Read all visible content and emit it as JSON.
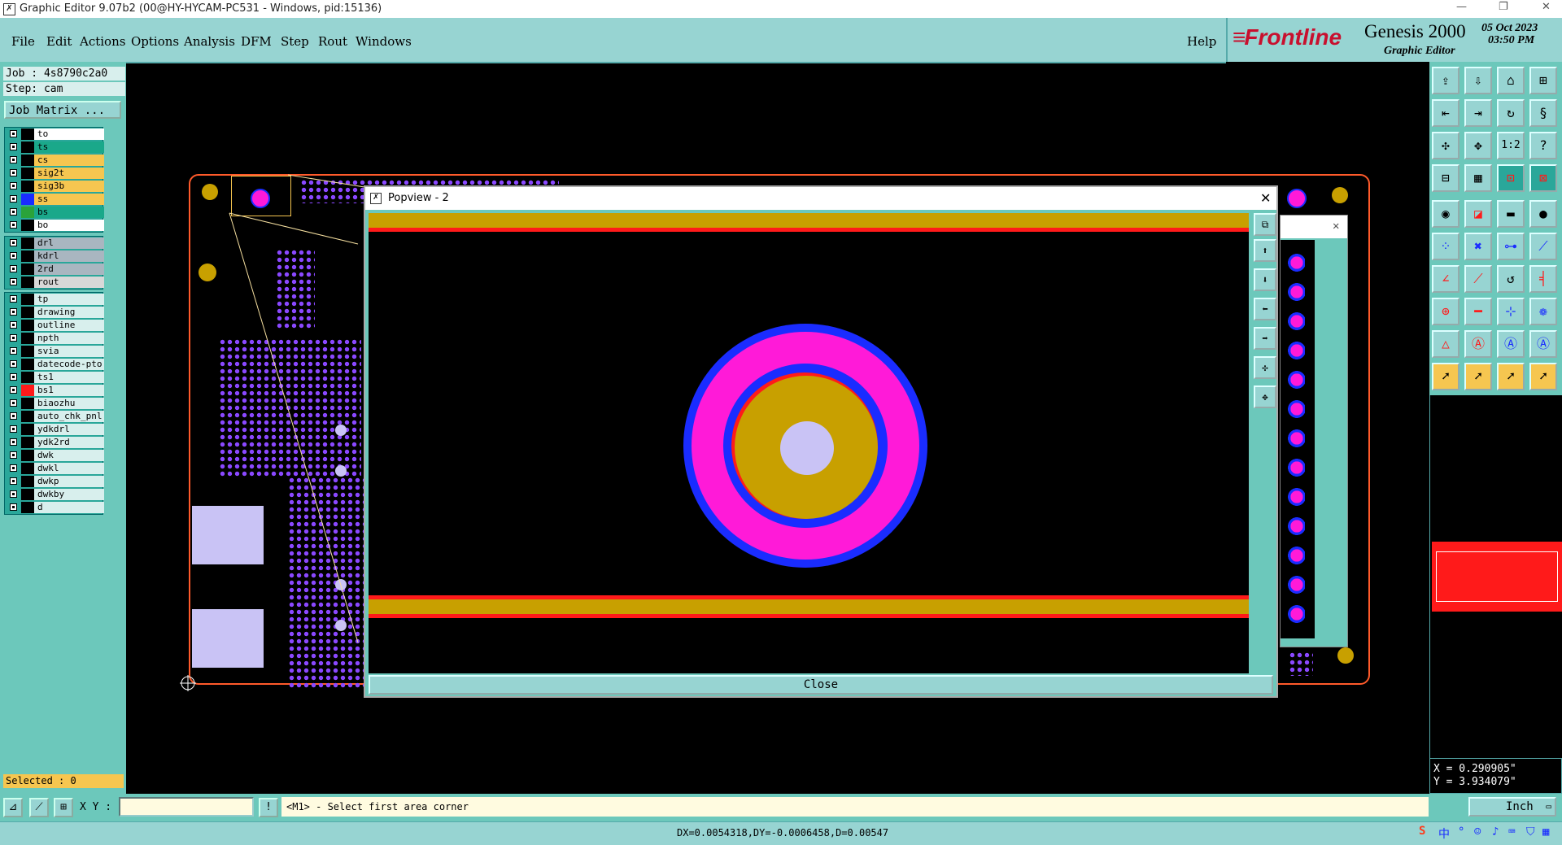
{
  "window": {
    "title": "Graphic Editor 9.07b2 (00@HY-HYCAM-PC531 - Windows, pid:15136)",
    "controls": [
      "—",
      "❐",
      "✕"
    ]
  },
  "menubar": {
    "items": [
      "File",
      "Edit",
      "Actions",
      "Options",
      "Analysis",
      "DFM",
      "Step",
      "Rout",
      "Windows"
    ],
    "help": "Help"
  },
  "brand": {
    "logo": "Frontline",
    "product": "Genesis 2000",
    "subtitle": "Graphic Editor",
    "date": "05 Oct 2023",
    "time": "03:50 PM"
  },
  "job": {
    "job_label": "Job : 4s8790c2a0",
    "step_label": "Step: cam",
    "matrix_button": "Job Matrix ..."
  },
  "layers": {
    "group1": [
      {
        "name": "to",
        "color": "#ffffff",
        "swatch": "#000000"
      },
      {
        "name": "ts",
        "color": "#1aa88a",
        "swatch": "#000000"
      },
      {
        "name": "cs",
        "color": "#f6c650",
        "swatch": "#000000"
      },
      {
        "name": "sig2t",
        "color": "#f6c650",
        "swatch": "#000000"
      },
      {
        "name": "sig3b",
        "color": "#f6c650",
        "swatch": "#000000"
      },
      {
        "name": "ss",
        "color": "#f6c650",
        "swatch": "#1a2cff"
      },
      {
        "name": "bs",
        "color": "#1aa88a",
        "swatch": "#2aa33a"
      },
      {
        "name": "bo",
        "color": "#ffffff",
        "swatch": "#000000"
      }
    ],
    "group2": [
      {
        "name": "drl",
        "color": "#a9b6c0",
        "swatch": "#000000"
      },
      {
        "name": "kdrl",
        "color": "#a9b6c0",
        "swatch": "#000000"
      },
      {
        "name": "2rd",
        "color": "#a9b6c0",
        "swatch": "#000000"
      },
      {
        "name": "rout",
        "color": "#d8d8d8",
        "swatch": "#000000"
      }
    ],
    "group3": [
      {
        "name": "tp",
        "color": "#d8efed",
        "swatch": "#000000"
      },
      {
        "name": "drawing",
        "color": "#d8efed",
        "swatch": "#000000"
      },
      {
        "name": "outline",
        "color": "#d8efed",
        "swatch": "#000000"
      },
      {
        "name": "npth",
        "color": "#d8efed",
        "swatch": "#000000"
      },
      {
        "name": "svia",
        "color": "#d8efed",
        "swatch": "#000000"
      },
      {
        "name": "datecode-pto",
        "color": "#d8efed",
        "swatch": "#000000"
      },
      {
        "name": "ts1",
        "color": "#d8efed",
        "swatch": "#000000"
      },
      {
        "name": "bs1",
        "color": "#d8efed",
        "swatch": "#ff1a1a"
      },
      {
        "name": "biaozhu",
        "color": "#d8efed",
        "swatch": "#000000"
      },
      {
        "name": "auto_chk_pnl",
        "color": "#d8efed",
        "swatch": "#000000"
      },
      {
        "name": "ydkdrl",
        "color": "#d8efed",
        "swatch": "#000000"
      },
      {
        "name": "ydk2rd",
        "color": "#d8efed",
        "swatch": "#000000"
      },
      {
        "name": "dwk",
        "color": "#d8efed",
        "swatch": "#000000"
      },
      {
        "name": "dwkl",
        "color": "#d8efed",
        "swatch": "#000000"
      },
      {
        "name": "dwkp",
        "color": "#d8efed",
        "swatch": "#000000"
      },
      {
        "name": "dwkby",
        "color": "#d8efed",
        "swatch": "#000000"
      },
      {
        "name": "d",
        "color": "#d8efed",
        "swatch": "#000000"
      }
    ]
  },
  "selected": "Selected : 0",
  "command": {
    "xy_label": "X Y :",
    "xy_value": "",
    "prompt": "<M1> - Select first area corner",
    "unit": "Inch"
  },
  "coords": {
    "x": "X = 0.290905\"",
    "y": "Y = 3.934079\""
  },
  "status": {
    "measure": "DX=0.0054318,DY=-0.0006458,D=0.00547"
  },
  "popview": {
    "title": "Popview - 2",
    "close_label": "Close"
  },
  "colors": {
    "panel": "#6cc8bb",
    "menu": "#97d4d2",
    "board_outline": "#ff5a2a",
    "via_dots": "#8a48ff",
    "pad_outer": "#1a2cff",
    "pad_ring": "#ff1ad8",
    "pad_copper": "#c8a000",
    "pad_hole": "#c9c3f5",
    "trace_red": "#ff1a1a"
  }
}
